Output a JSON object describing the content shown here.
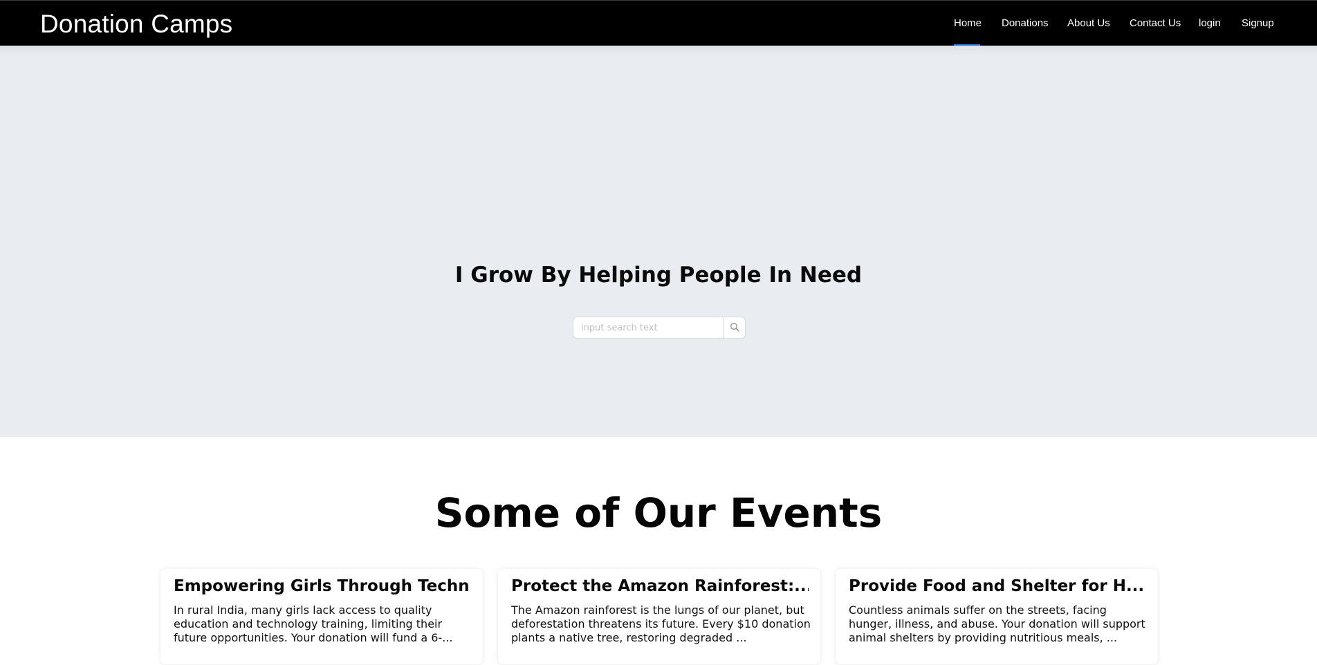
{
  "navbar": {
    "brand": "Donation Camps",
    "items": [
      {
        "label": "Home",
        "active": true
      },
      {
        "label": "Donations"
      },
      {
        "label": "About Us"
      },
      {
        "label": "Contact Us"
      },
      {
        "label": "login"
      },
      {
        "label": "Signup"
      }
    ],
    "active_color": "#1677ff"
  },
  "hero": {
    "title": "I Grow By Helping People In Need",
    "search": {
      "placeholder": "input search text",
      "value": "",
      "button_icon": "search-icon"
    }
  },
  "events": {
    "title": "Some of Our Events",
    "cards": [
      {
        "title": "Empowering Girls Through Techn...",
        "description": "In rural India, many girls lack access to quality education and technology training, limiting their future opportunities. Your donation will fund a 6-..."
      },
      {
        "title": "Protect the Amazon Rainforest:...",
        "description": "The Amazon rainforest is the lungs of our planet, but deforestation threatens its future. Every $10 donation plants a native tree, restoring degraded ..."
      },
      {
        "title": "Provide Food and Shelter for H...",
        "description": "Countless animals suffer on the streets, facing hunger, illness, and abuse. Your donation will support animal shelters by providing nutritious meals, ..."
      }
    ]
  }
}
